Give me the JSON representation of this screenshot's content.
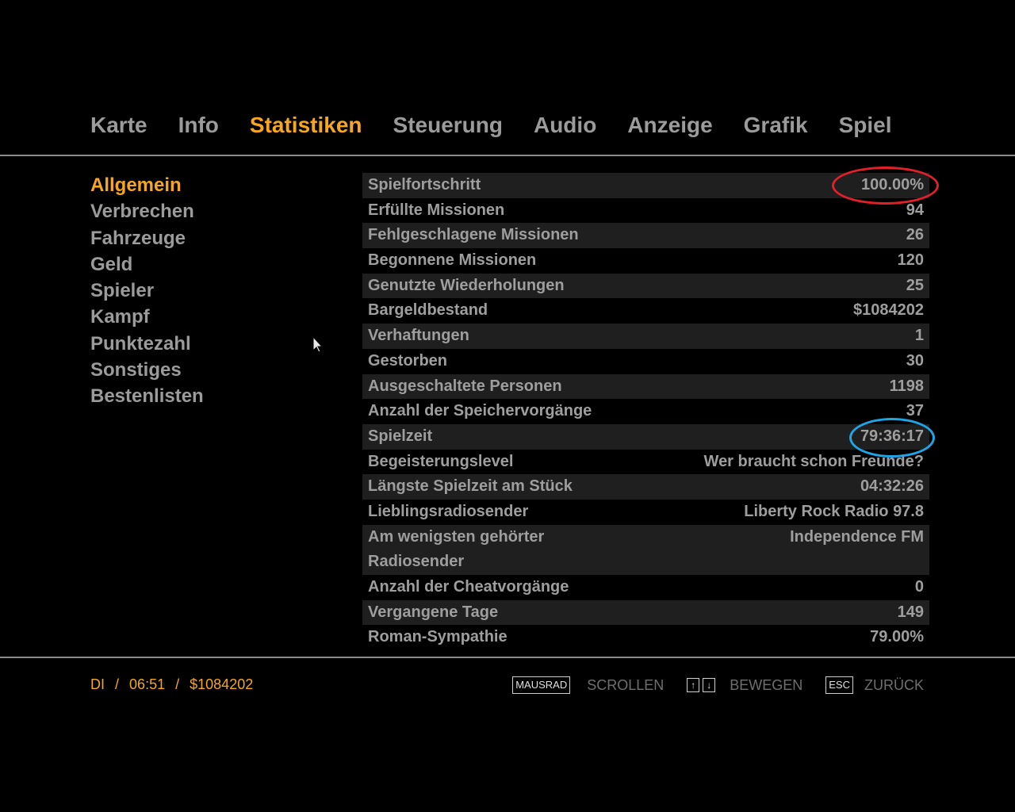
{
  "tabs": [
    "Karte",
    "Info",
    "Statistiken",
    "Steuerung",
    "Audio",
    "Anzeige",
    "Grafik",
    "Spiel"
  ],
  "active_tab": "Statistiken",
  "categories": [
    "Allgemein",
    "Verbrechen",
    "Fahrzeuge",
    "Geld",
    "Spieler",
    "Kampf",
    "Punktezahl",
    "Sonstiges",
    "Bestenlisten"
  ],
  "active_category": "Allgemein",
  "stats": [
    {
      "label": "Spielfortschritt",
      "value": "100.00%"
    },
    {
      "label": "Erfüllte Missionen",
      "value": "94"
    },
    {
      "label": "Fehlgeschlagene Missionen",
      "value": "26"
    },
    {
      "label": "Begonnene Missionen",
      "value": "120"
    },
    {
      "label": "Genutzte Wiederholungen",
      "value": "25"
    },
    {
      "label": "Bargeldbestand",
      "value": "$1084202"
    },
    {
      "label": "Verhaftungen",
      "value": "1"
    },
    {
      "label": "Gestorben",
      "value": "30"
    },
    {
      "label": "Ausgeschaltete Personen",
      "value": "1198"
    },
    {
      "label": "Anzahl der Speichervorgänge",
      "value": "37"
    },
    {
      "label": "Spielzeit",
      "value": "79:36:17"
    },
    {
      "label": "Begeisterungslevel",
      "value": "Wer braucht schon Freunde?"
    },
    {
      "label": "Längste Spielzeit am Stück",
      "value": "04:32:26"
    },
    {
      "label": "Lieblingsradiosender",
      "value": "Liberty Rock Radio 97.8"
    },
    {
      "label": "Am wenigsten gehörter Radiosender",
      "value": "Independence FM"
    },
    {
      "label": "Anzahl der Cheatvorgänge",
      "value": "0"
    },
    {
      "label": "Vergangene Tage",
      "value": "149"
    },
    {
      "label": "Roman-Sympathie",
      "value": "79.00%"
    }
  ],
  "footer": {
    "day": "DI",
    "sep": "/",
    "time": "06:51",
    "money": "$1084202",
    "mousewheel_key": "MAUSRAD",
    "scroll_label": "SCROLLEN",
    "up_key": "↑",
    "down_key": "↓",
    "move_label": "BEWEGEN",
    "esc_key": "ESC",
    "back_label": "ZURÜCK"
  },
  "colors": {
    "accent": "#f5a623",
    "text": "#9b9b9b",
    "highlight_red": "#e0202a",
    "highlight_blue": "#1ea5e6"
  }
}
